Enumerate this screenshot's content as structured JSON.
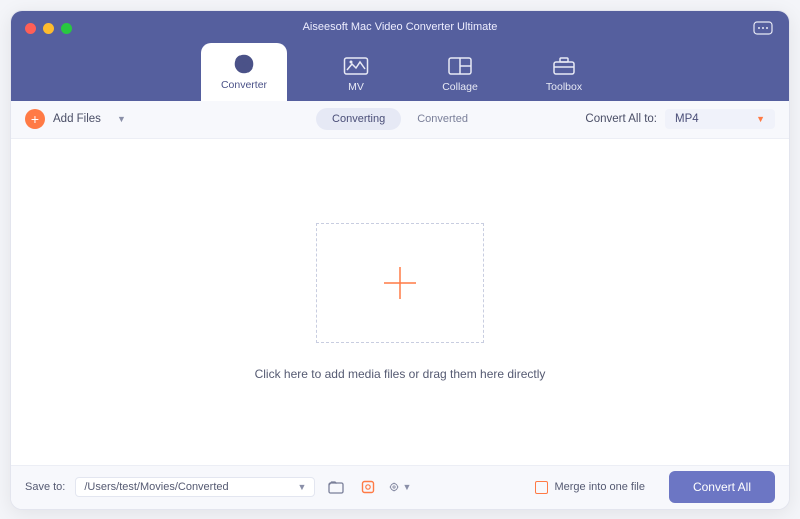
{
  "window": {
    "title": "Aiseesoft Mac Video Converter Ultimate"
  },
  "tabs": [
    {
      "label": "Converter",
      "active": true
    },
    {
      "label": "MV"
    },
    {
      "label": "Collage"
    },
    {
      "label": "Toolbox"
    }
  ],
  "toolbar": {
    "add_files": "Add Files",
    "segments": {
      "converting": "Converting",
      "converted": "Converted"
    },
    "convert_all_to": "Convert All to:",
    "format": "MP4"
  },
  "dropzone": {
    "hint": "Click here to add media files or drag them here directly"
  },
  "footer": {
    "save_to_label": "Save to:",
    "save_path": "/Users/test/Movies/Converted",
    "merge_label": "Merge into one file",
    "convert_all": "Convert All"
  }
}
